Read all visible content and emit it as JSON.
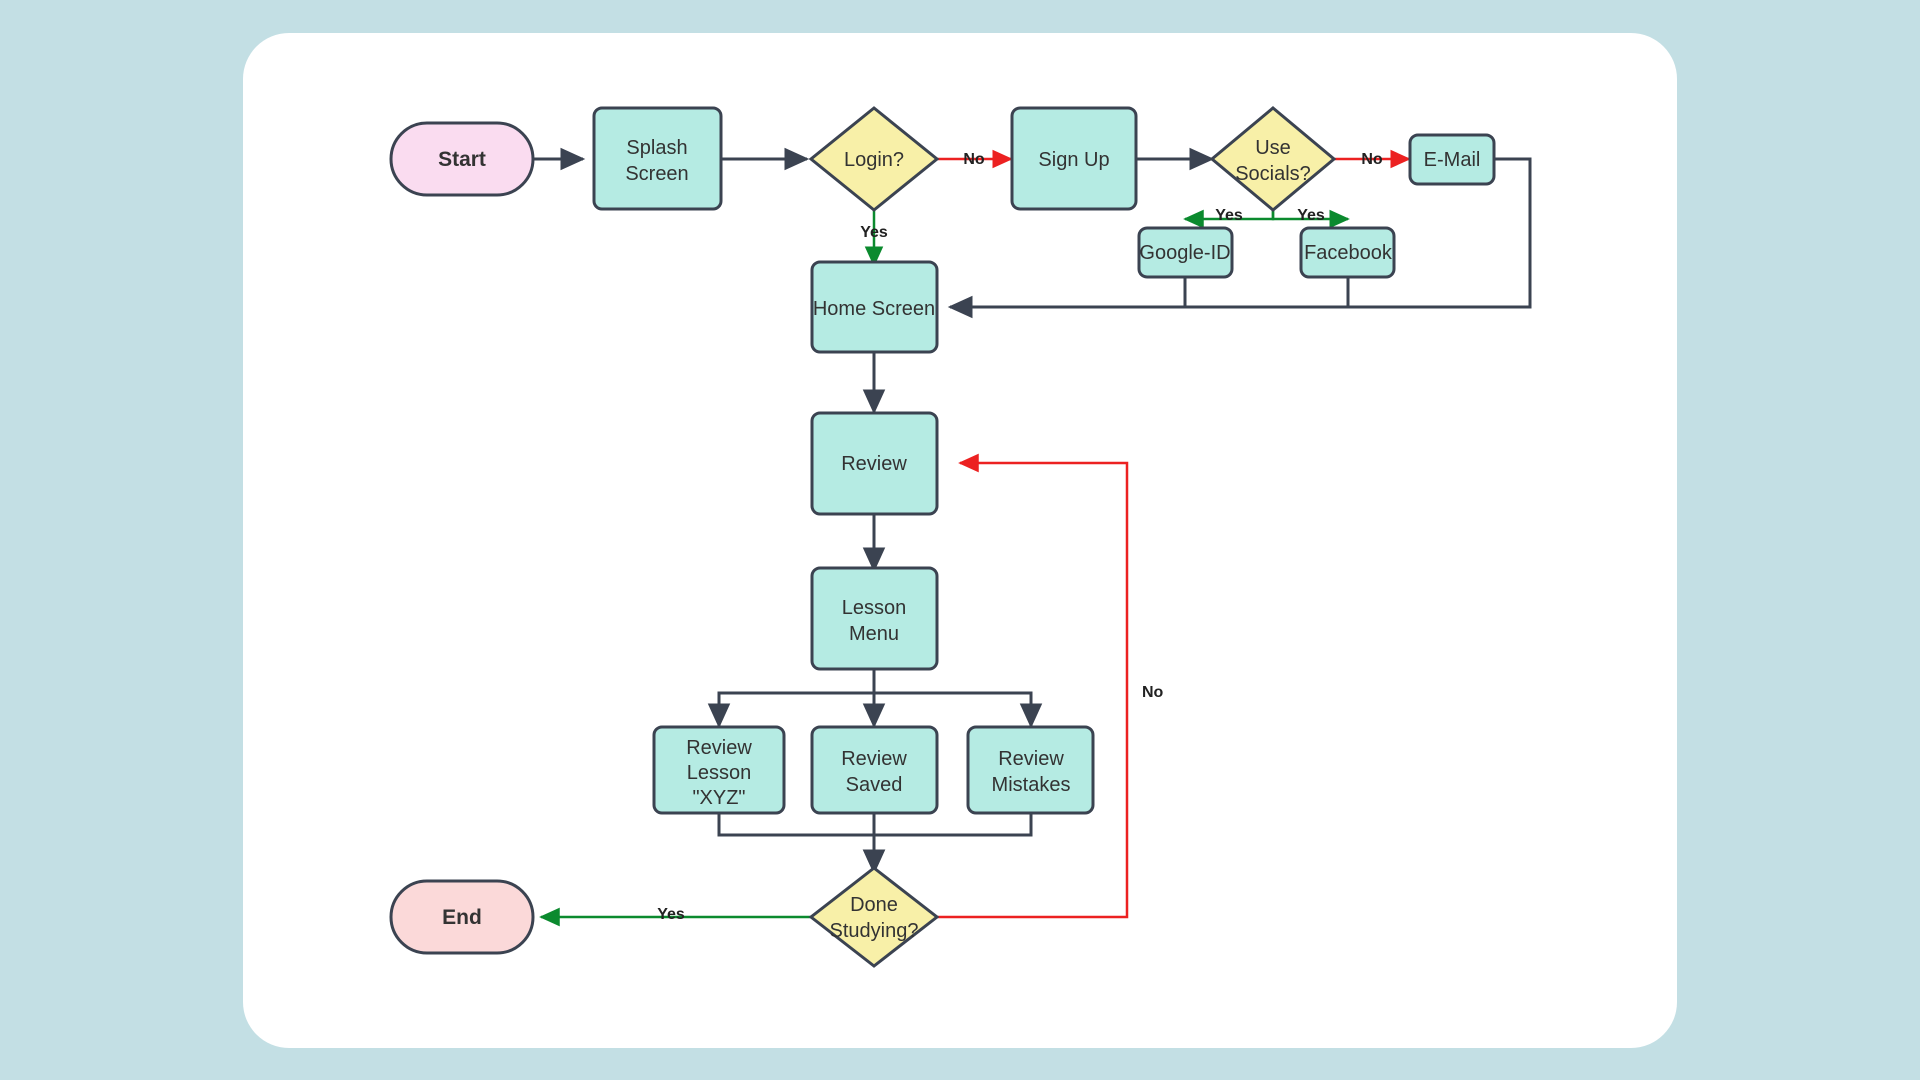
{
  "canvas": {
    "background_color": "#c3dfe4",
    "panel_color": "#ffffff"
  },
  "palette": {
    "process_fill": "#b5ebe3",
    "decision_fill": "#f8f0a8",
    "start_fill": "#fadcf0",
    "end_fill": "#fbd9d9",
    "stroke": "#3b4351",
    "yes_color": "#0b8a2e",
    "no_color": "#ec2121"
  },
  "chart_data": {
    "type": "diagram",
    "title": "App Study Flow",
    "nodes": [
      {
        "id": "start",
        "label": "Start",
        "shape": "stadium",
        "role": "start"
      },
      {
        "id": "splash",
        "label": "Splash\nScreen",
        "shape": "rect",
        "role": "process"
      },
      {
        "id": "login",
        "label": "Login?",
        "shape": "diamond",
        "role": "decision"
      },
      {
        "id": "signup",
        "label": "Sign Up",
        "shape": "rect",
        "role": "process"
      },
      {
        "id": "use_socials",
        "label": "Use\nSocials?",
        "shape": "diamond",
        "role": "decision"
      },
      {
        "id": "email",
        "label": "E-Mail",
        "shape": "rect",
        "role": "process"
      },
      {
        "id": "google_id",
        "label": "Google-ID",
        "shape": "rect",
        "role": "process"
      },
      {
        "id": "facebook",
        "label": "Facebook",
        "shape": "rect",
        "role": "process"
      },
      {
        "id": "home_screen",
        "label": "Home Screen",
        "shape": "rect",
        "role": "process"
      },
      {
        "id": "review",
        "label": "Review",
        "shape": "rect",
        "role": "process"
      },
      {
        "id": "lesson_menu",
        "label": "Lesson\nMenu",
        "shape": "rect",
        "role": "process"
      },
      {
        "id": "review_lesson",
        "label": "Review\nLesson\n\"XYZ\"",
        "shape": "rect",
        "role": "process"
      },
      {
        "id": "review_saved",
        "label": "Review\nSaved",
        "shape": "rect",
        "role": "process"
      },
      {
        "id": "review_mistakes",
        "label": "Review\nMistakes",
        "shape": "rect",
        "role": "process"
      },
      {
        "id": "done_studying",
        "label": "Done\nStudying?",
        "shape": "diamond",
        "role": "decision"
      },
      {
        "id": "end",
        "label": "End",
        "shape": "stadium",
        "role": "end"
      }
    ],
    "edges": [
      {
        "from": "start",
        "to": "splash",
        "label": "",
        "color": "stroke"
      },
      {
        "from": "splash",
        "to": "login",
        "label": "",
        "color": "stroke"
      },
      {
        "from": "login",
        "to": "signup",
        "label": "No",
        "color": "no"
      },
      {
        "from": "login",
        "to": "home_screen",
        "label": "Yes",
        "color": "yes"
      },
      {
        "from": "signup",
        "to": "use_socials",
        "label": "",
        "color": "stroke"
      },
      {
        "from": "use_socials",
        "to": "email",
        "label": "No",
        "color": "no"
      },
      {
        "from": "use_socials",
        "to": "google_id",
        "label": "Yes",
        "color": "yes"
      },
      {
        "from": "use_socials",
        "to": "facebook",
        "label": "Yes",
        "color": "yes"
      },
      {
        "from": "google_id",
        "to": "home_screen",
        "label": "",
        "color": "stroke"
      },
      {
        "from": "facebook",
        "to": "home_screen",
        "label": "",
        "color": "stroke"
      },
      {
        "from": "email",
        "to": "home_screen",
        "label": "",
        "color": "stroke"
      },
      {
        "from": "home_screen",
        "to": "review",
        "label": "",
        "color": "stroke"
      },
      {
        "from": "review",
        "to": "lesson_menu",
        "label": "",
        "color": "stroke"
      },
      {
        "from": "lesson_menu",
        "to": "review_lesson",
        "label": "",
        "color": "stroke"
      },
      {
        "from": "lesson_menu",
        "to": "review_saved",
        "label": "",
        "color": "stroke"
      },
      {
        "from": "lesson_menu",
        "to": "review_mistakes",
        "label": "",
        "color": "stroke"
      },
      {
        "from": "review_lesson",
        "to": "done_studying",
        "label": "",
        "color": "stroke"
      },
      {
        "from": "review_saved",
        "to": "done_studying",
        "label": "",
        "color": "stroke"
      },
      {
        "from": "review_mistakes",
        "to": "done_studying",
        "label": "",
        "color": "stroke"
      },
      {
        "from": "done_studying",
        "to": "end",
        "label": "Yes",
        "color": "yes"
      },
      {
        "from": "done_studying",
        "to": "review",
        "label": "No",
        "color": "no"
      }
    ]
  },
  "labels": {
    "start": "Start",
    "splash_1": "Splash",
    "splash_2": "Screen",
    "login": "Login?",
    "signup": "Sign Up",
    "use_socials_1": "Use",
    "use_socials_2": "Socials?",
    "email": "E-Mail",
    "google_id": "Google-ID",
    "facebook": "Facebook",
    "home_screen": "Home Screen",
    "review": "Review",
    "lesson_menu_1": "Lesson",
    "lesson_menu_2": "Menu",
    "review_lesson_1": "Review",
    "review_lesson_2": "Lesson",
    "review_lesson_3": "\"XYZ\"",
    "review_saved_1": "Review",
    "review_saved_2": "Saved",
    "review_mistakes_1": "Review",
    "review_mistakes_2": "Mistakes",
    "done_studying_1": "Done",
    "done_studying_2": "Studying?",
    "end": "End"
  },
  "edge_labels": {
    "login_no": "No",
    "login_yes": "Yes",
    "socials_no": "No",
    "socials_yes_left": "Yes",
    "socials_yes_right": "Yes",
    "done_yes": "Yes",
    "done_no": "No"
  }
}
